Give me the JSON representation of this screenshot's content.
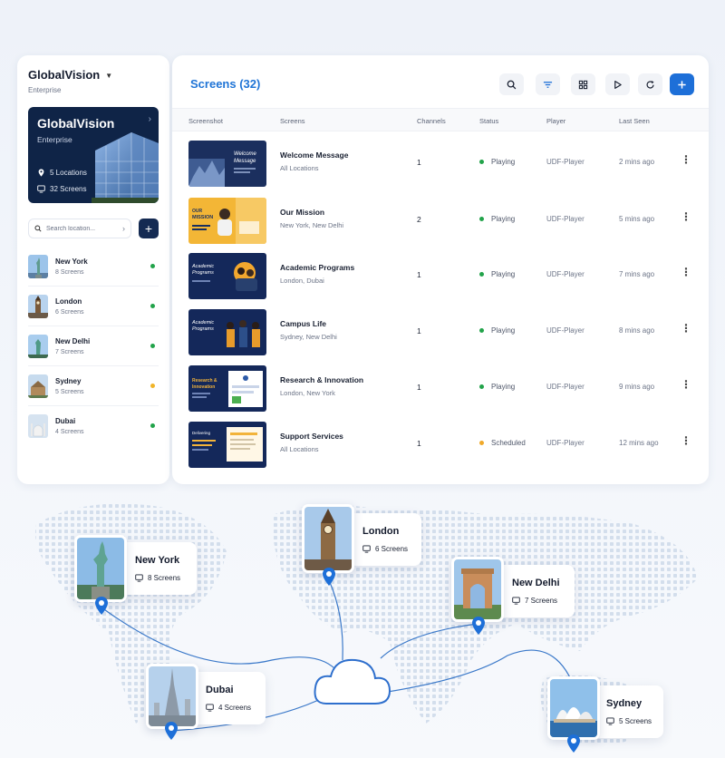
{
  "sidebar": {
    "org_name": "GlobalVision",
    "org_sub": "Enterprise",
    "hero": {
      "title": "GlobalVision",
      "subtitle": "Enterprise",
      "locations": "5 Locations",
      "screens": "32 Screens"
    },
    "search_placeholder": "Search location...",
    "add_label": "+",
    "locations": [
      {
        "name": "New York",
        "screens": "8 Screens",
        "status_color": "#22a34a"
      },
      {
        "name": "London",
        "screens": "6 Screens",
        "status_color": "#22a34a"
      },
      {
        "name": "New Delhi",
        "screens": "7 Screens",
        "status_color": "#22a34a"
      },
      {
        "name": "Sydney",
        "screens": "5 Screens",
        "status_color": "#f0b429"
      },
      {
        "name": "Dubai",
        "screens": "4 Screens",
        "status_color": "#22a34a"
      }
    ]
  },
  "main": {
    "title": "Screens (32)",
    "toolbar_icons": [
      "search-icon",
      "filter-icon",
      "grid-icon",
      "play-icon",
      "refresh-icon",
      "plus-icon"
    ],
    "columns": [
      "Screenshot",
      "Screens",
      "Channels",
      "Status",
      "Player",
      "Last Seen"
    ],
    "rows": [
      {
        "name": "Welcome Message",
        "locations": "All Locations",
        "channels": "1",
        "status": "Playing",
        "status_color": "#22a34a",
        "player": "UDF-Player",
        "last_seen": "2 mins ago",
        "thumb_text": "Welcome Message"
      },
      {
        "name": "Our Mission",
        "locations": "New York, New Delhi",
        "channels": "2",
        "status": "Playing",
        "status_color": "#22a34a",
        "player": "UDF-Player",
        "last_seen": "5 mins ago",
        "thumb_text": "MISSION"
      },
      {
        "name": "Academic Programs",
        "locations": "London, Dubai",
        "channels": "1",
        "status": "Playing",
        "status_color": "#22a34a",
        "player": "UDF-Player",
        "last_seen": "7 mins ago",
        "thumb_text": "Academic Programs"
      },
      {
        "name": "Campus Life",
        "locations": "Sydney, New Delhi",
        "channels": "1",
        "status": "Playing",
        "status_color": "#22a34a",
        "player": "UDF-Player",
        "last_seen": "8 mins ago",
        "thumb_text": "Academic Programs"
      },
      {
        "name": "Research & Innovation",
        "locations": "London, New York",
        "channels": "1",
        "status": "Playing",
        "status_color": "#22a34a",
        "player": "UDF-Player",
        "last_seen": "9 mins ago",
        "thumb_text": "Innovation"
      },
      {
        "name": "Support Services",
        "locations": "All Locations",
        "channels": "1",
        "status": "Scheduled",
        "status_color": "#f0a92a",
        "player": "UDF-Player",
        "last_seen": "12 mins ago",
        "thumb_text": "Delivering"
      }
    ]
  },
  "map": {
    "cities": [
      {
        "name": "New York",
        "screens": "8 Screens",
        "landmark": "statue-of-liberty"
      },
      {
        "name": "London",
        "screens": "6 Screens",
        "landmark": "big-ben"
      },
      {
        "name": "New Delhi",
        "screens": "7 Screens",
        "landmark": "india-gate"
      },
      {
        "name": "Dubai",
        "screens": "4 Screens",
        "landmark": "burj-khalifa"
      },
      {
        "name": "Sydney",
        "screens": "5 Screens",
        "landmark": "sydney-opera-house"
      }
    ],
    "hub_icon": "cloud-icon",
    "accent": "#1d6fd8"
  }
}
